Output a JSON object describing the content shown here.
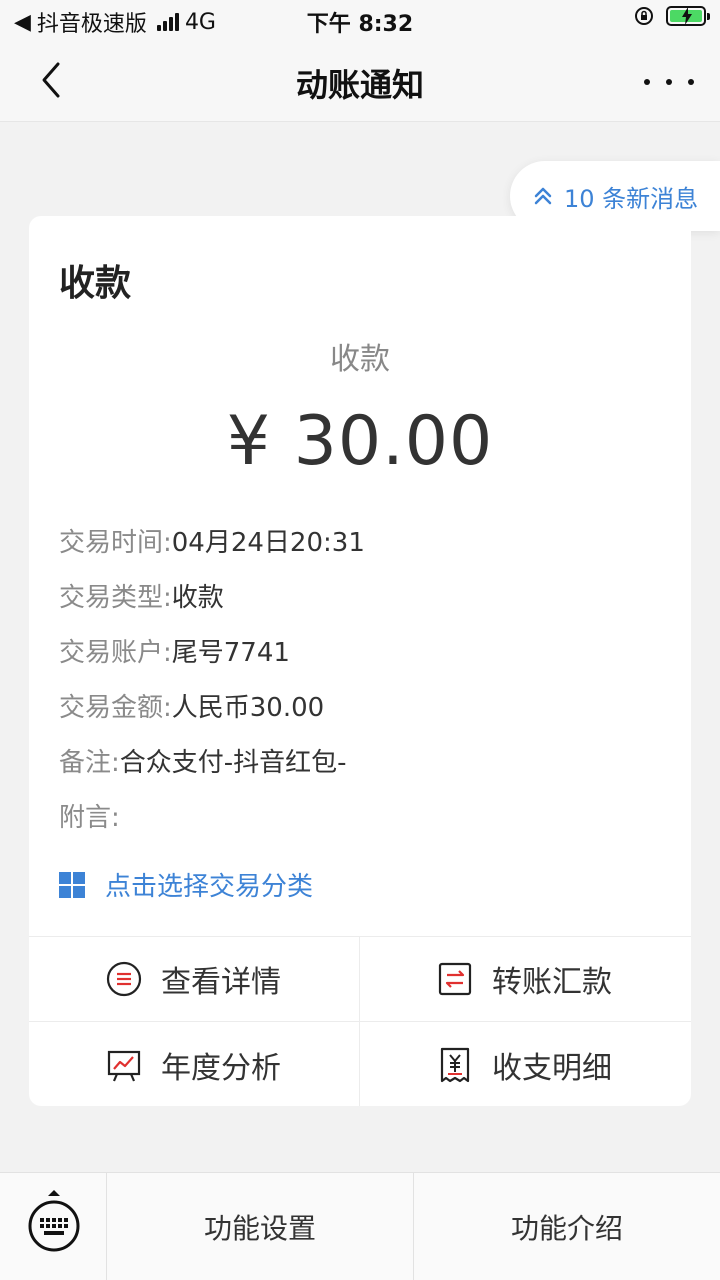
{
  "status_bar": {
    "back_app": "抖音极速版",
    "network": "4G",
    "time": "下午 8:32"
  },
  "nav": {
    "title": "动账通知"
  },
  "new_messages": {
    "label": "10 条新消息"
  },
  "card": {
    "title": "收款",
    "center_label": "收款",
    "amount": "¥ 30.00",
    "details": [
      {
        "key": "交易时间:",
        "value": "04月24日20:31"
      },
      {
        "key": "交易类型:",
        "value": "收款"
      },
      {
        "key": "交易账户:",
        "value": "尾号7741"
      },
      {
        "key": "交易金额:",
        "value": "人民币30.00"
      },
      {
        "key": "备注:",
        "value": "合众支付-抖音红包-"
      },
      {
        "key": "附言:",
        "value": ""
      }
    ],
    "category_label": "点击选择交易分类"
  },
  "actions": {
    "view_details": "查看详情",
    "transfer": "转账汇款",
    "annual_analysis": "年度分析",
    "income_expense": "收支明细"
  },
  "bottom_bar": {
    "settings": "功能设置",
    "intro": "功能介绍"
  },
  "colors": {
    "accent": "#3d83d6",
    "icon_red": "#e0302f",
    "background": "#f2f2f2",
    "battery": "#4cd964"
  }
}
